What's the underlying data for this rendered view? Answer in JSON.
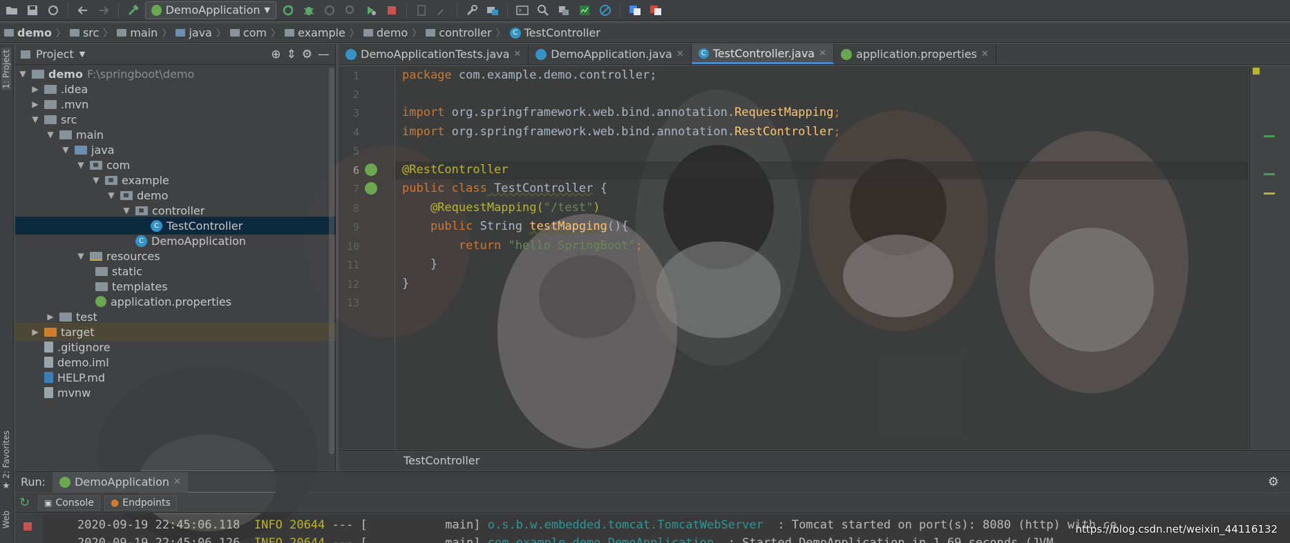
{
  "toolbar": {
    "run_config": "DemoApplication"
  },
  "breadcrumb": [
    "demo",
    "src",
    "main",
    "java",
    "com",
    "example",
    "demo",
    "controller",
    "TestController"
  ],
  "left_stripe": {
    "project_label": "1: Project",
    "favorites_label": "2: Favorites",
    "web_label": "Web"
  },
  "project_panel": {
    "title": "Project",
    "tree": [
      {
        "label": "demo",
        "note": "F:\\springboot\\demo"
      },
      {
        "label": ".idea"
      },
      {
        "label": ".mvn"
      },
      {
        "label": "src"
      },
      {
        "label": "main"
      },
      {
        "label": "java"
      },
      {
        "label": "com"
      },
      {
        "label": "example"
      },
      {
        "label": "demo"
      },
      {
        "label": "controller"
      },
      {
        "label": "TestController"
      },
      {
        "label": "DemoApplication"
      },
      {
        "label": "resources"
      },
      {
        "label": "static"
      },
      {
        "label": "templates"
      },
      {
        "label": "application.properties"
      },
      {
        "label": "test"
      },
      {
        "label": "target"
      },
      {
        "label": ".gitignore"
      },
      {
        "label": "demo.iml"
      },
      {
        "label": "HELP.md"
      },
      {
        "label": "mvnw"
      }
    ]
  },
  "editor": {
    "tabs": [
      "DemoApplicationTests.java",
      "DemoApplication.java",
      "TestController.java",
      "application.properties"
    ],
    "active_tab": "TestController.java",
    "line_numbers": [
      "1",
      "2",
      "3",
      "4",
      "5",
      "6",
      "7",
      "8",
      "9",
      "10",
      "11",
      "12",
      "13"
    ],
    "code": {
      "l1_kw": "package",
      "l1_rest": " com.example.demo.controller;",
      "l3_kw": "import",
      "l3_pkg": " org.springframework.web.bind.annotation.",
      "l3_cls": "RequestMapping",
      "l3_end": ";",
      "l4_kw": "import",
      "l4_pkg": " org.springframework.web.bind.annotation.",
      "l4_cls": "RestController",
      "l4_end": ";",
      "l6": "@RestController",
      "l7_kw": "public class",
      "l7_name": " TestController",
      "l7_end": " {",
      "l8_ann": "    @RequestMapping(",
      "l8_str": "\"/test\"",
      "l8_end": ")",
      "l9_kw": "    public",
      "l9_type": " String ",
      "l9_fn": "testMapging",
      "l9_end": "(){",
      "l10_kw": "        return",
      "l10_str": " \"hello SpringBoot\"",
      "l10_end": ";",
      "l11": "    }",
      "l12": "}"
    },
    "footer": "TestController"
  },
  "run_panel": {
    "label": "Run:",
    "tab": "DemoApplication",
    "console_tab": "Console",
    "endpoints_tab": "Endpoints",
    "log": [
      {
        "time": "2020-09-19 22:45:06.118",
        "level": "INFO",
        "pid": "20644",
        "sep": " --- [",
        "thread": "           main]",
        "logger": "o.s.b.w.embedded.tomcat.TomcatWebServer",
        "msg": "  : Tomcat started on port(s): 8080 (http) with co"
      },
      {
        "time": "2020-09-19 22:45:06.126",
        "level": "INFO",
        "pid": "20644",
        "sep": " --- [",
        "thread": "           main]",
        "logger": "com.example.demo.DemoApplication",
        "msg": "  : Started DemoApplication in 1.69 seconds (JVM"
      }
    ]
  },
  "watermark": "https://blog.csdn.net/weixin_44116132",
  "colors": {
    "keyword": "#cc7832",
    "annotation": "#bbb529",
    "string": "#6a8759",
    "function": "#ffc66d",
    "selection": "#0d293e",
    "accent": "#4a88c7"
  }
}
